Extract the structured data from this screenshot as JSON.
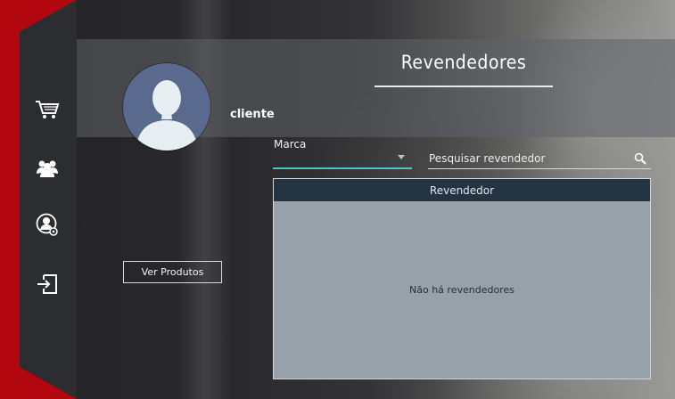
{
  "page": {
    "title": "Revendedores"
  },
  "user": {
    "name": "cliente"
  },
  "sidebar": {
    "items": [
      {
        "icon": "cart-icon"
      },
      {
        "icon": "users-icon"
      },
      {
        "icon": "user-settings-icon"
      },
      {
        "icon": "logout-icon"
      }
    ]
  },
  "filter": {
    "brand_label": "Marca"
  },
  "search": {
    "placeholder": "Pesquisar revendedor"
  },
  "table": {
    "columns": [
      "Revendedor"
    ],
    "rows": [],
    "empty_message": "Não há revendedores"
  },
  "actions": {
    "view_products": "Ver Produtos"
  },
  "colors": {
    "accent_red": "#b3070f",
    "sidebar": "#2c2d31",
    "combo_underline": "#4fc3c9",
    "table_header": "#243442",
    "table_body": "#96a1aa",
    "avatar": "#5a6a8e"
  }
}
